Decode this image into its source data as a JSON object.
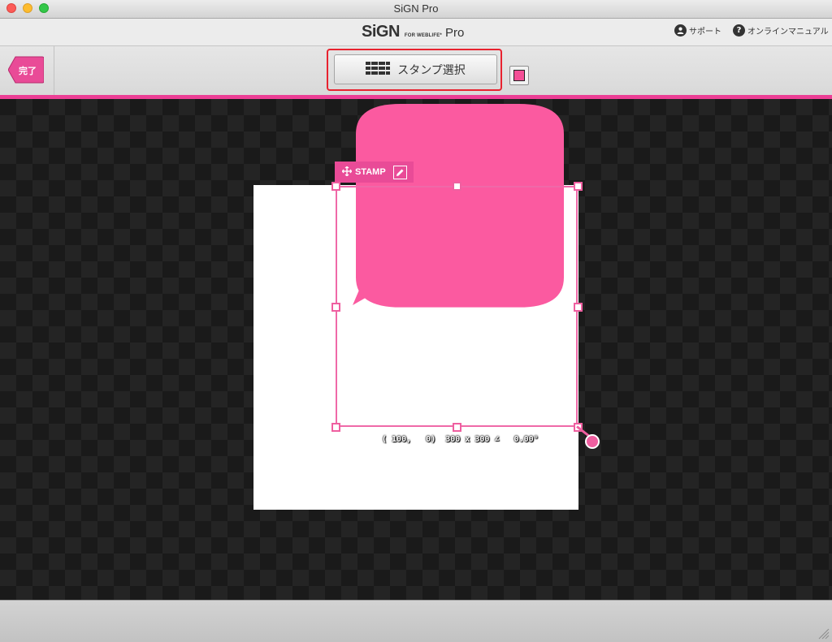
{
  "window": {
    "title": "SiGN Pro"
  },
  "header": {
    "logo_main": "SiGN",
    "logo_sub": "FOR WEBLIFE*",
    "logo_pro": "Pro",
    "support_label": "サポート",
    "manual_label": "オンラインマニュアル"
  },
  "toolbar": {
    "done_label": "完了",
    "stamp_select_label": "スタンプ選択",
    "color_swatch": "#f44f96"
  },
  "canvas": {
    "stamp_tab_label": "STAMP",
    "coordinate_readout": "( 100,   0)  300 x 300 ∠   0.00°",
    "bubble_color": "#fb5aa0",
    "selection_color": "#ef5fa0"
  },
  "icons": {
    "support": "person-circle-icon",
    "manual": "question-circle-icon",
    "stamp_select": "grid-icon",
    "move": "move-arrows-icon",
    "edit": "pencil-icon"
  }
}
